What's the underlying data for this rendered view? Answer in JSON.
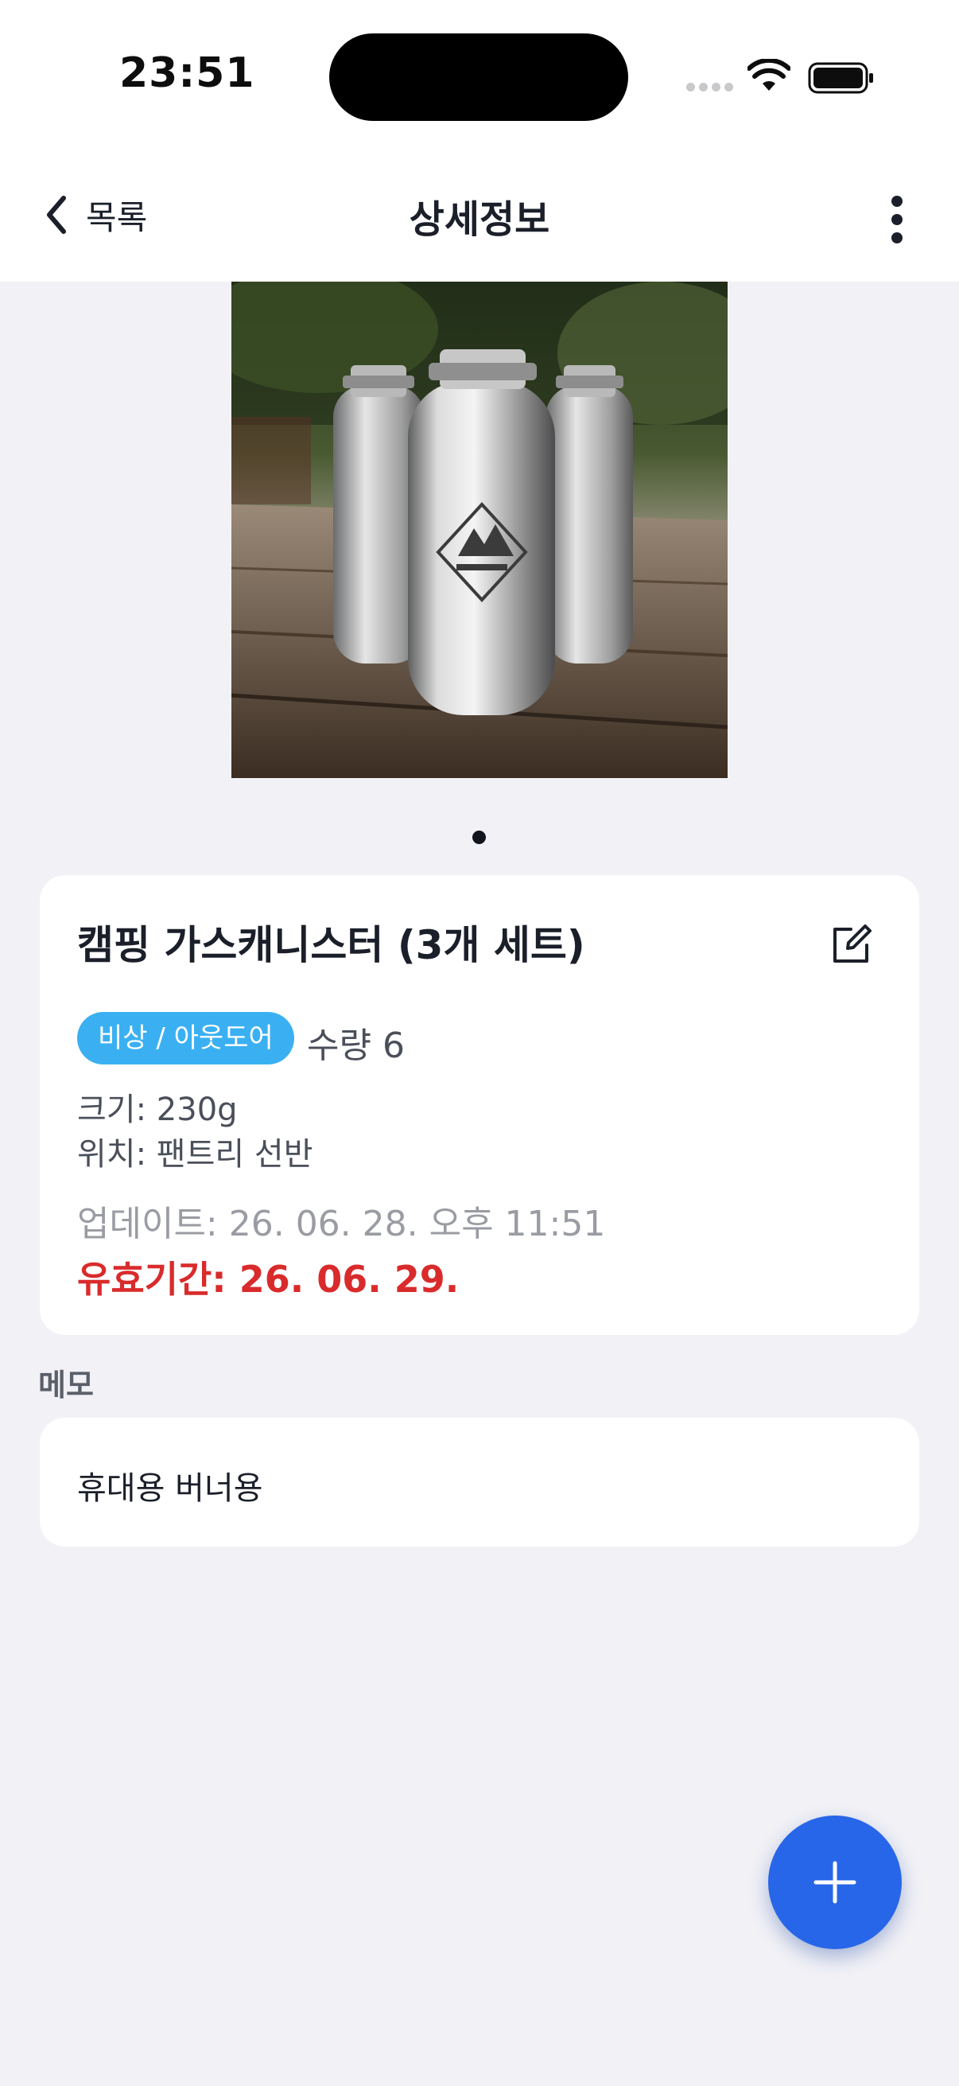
{
  "status_bar": {
    "time": "23:51",
    "icons": [
      "cellular-signal-icon",
      "wifi-icon",
      "battery-icon"
    ]
  },
  "nav": {
    "back_label": "목록",
    "title": "상세정보",
    "back_icon": "chevron-left-icon",
    "more_icon": "more-vertical-icon"
  },
  "gallery": {
    "image_description_icon": "photo",
    "page_count": 1,
    "current_page": 1
  },
  "item": {
    "name": "캠핑 가스캐니스터 (3개 세트)",
    "edit_icon": "edit-icon",
    "category": "비상 / 아웃도어",
    "quantity": "수량 6",
    "size": "크기: 230g",
    "location": "위치: 팬트리 선반",
    "updated": "업데이트: 26. 06. 28. 오후 11:51",
    "expiry": "유효기간: 26. 06. 29."
  },
  "memo": {
    "heading": "메모",
    "text": "휴대용 버너용"
  },
  "fab": {
    "icon": "plus-icon"
  },
  "colors": {
    "background": "#f1f1f6",
    "card": "#ffffff",
    "badge": "#3ab0f2",
    "expiry_warning": "#d92b2b",
    "fab": "#2766e8",
    "muted_text": "#9a9ca3"
  }
}
